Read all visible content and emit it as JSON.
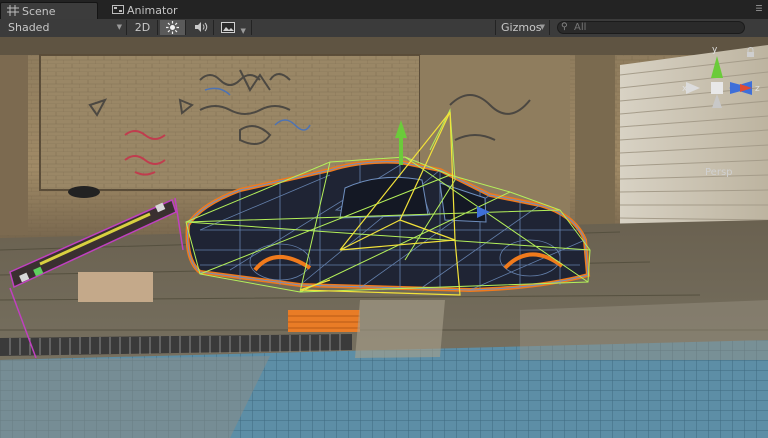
{
  "tabs": [
    {
      "label": "Scene",
      "icon": "grid-icon",
      "active": true
    },
    {
      "label": "Animator",
      "icon": "animator-icon",
      "active": false
    }
  ],
  "toolbar": {
    "draw_mode": "Shaded",
    "mode_2d": "2D",
    "lighting_icon": "sun-icon",
    "audio_icon": "speaker-icon",
    "effects_icon": "image-icon",
    "gizmos_label": "Gizmos",
    "search_placeholder": "All"
  },
  "gizmo": {
    "projection_label": "Persp",
    "axes": [
      "y",
      "x",
      "z"
    ],
    "colors": {
      "y": "#6bcb3a",
      "x": "#e04a34",
      "z": "#3e6fd9"
    }
  },
  "selection_outline_color": "#f07a1c",
  "wireframe_color": "#6f8fbf",
  "collider_color": "#b4f05a"
}
